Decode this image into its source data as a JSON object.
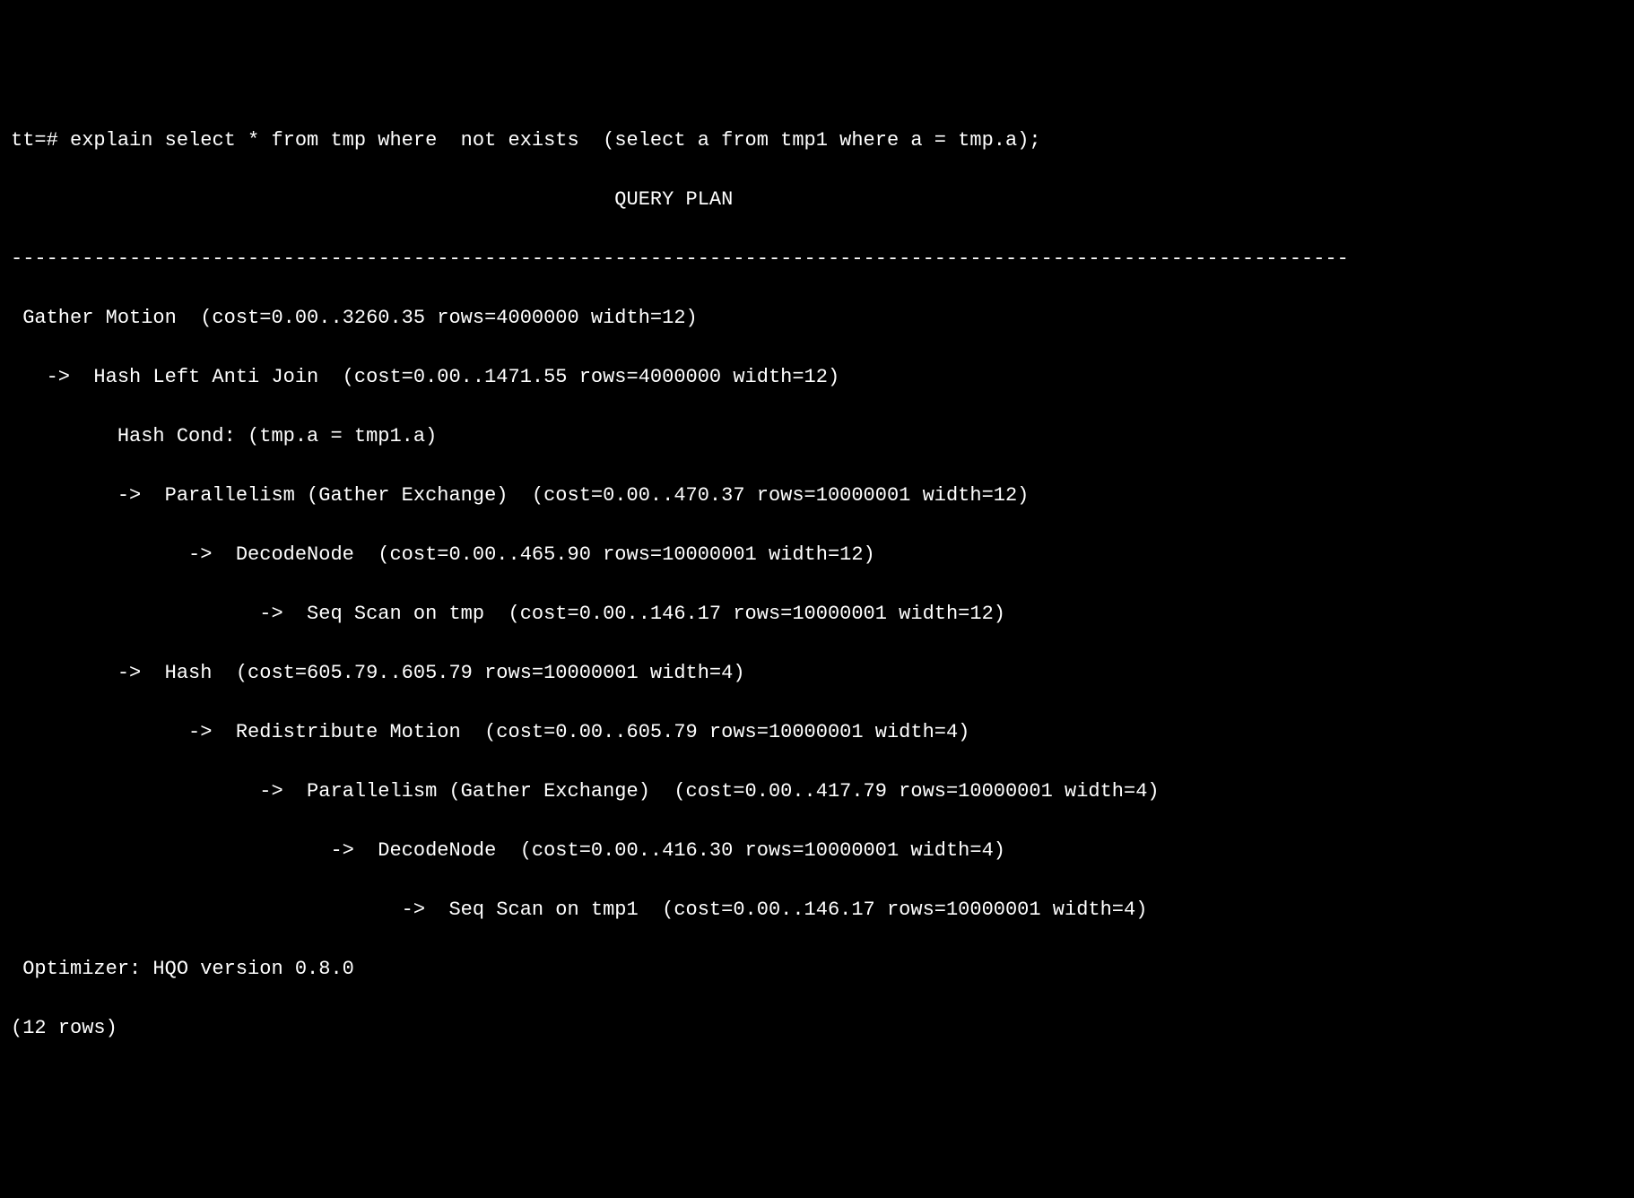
{
  "terminal": {
    "prompt": "tt=# ",
    "command": "explain select * from tmp where  not exists  (select a from tmp1 where a = tmp.a);",
    "plan_title": "                                                   QUERY PLAN",
    "separator": "-----------------------------------------------------------------------------------------------------------------",
    "plan_lines": [
      " Gather Motion  (cost=0.00..3260.35 rows=4000000 width=12)",
      "   ->  Hash Left Anti Join  (cost=0.00..1471.55 rows=4000000 width=12)",
      "         Hash Cond: (tmp.a = tmp1.a)",
      "         ->  Parallelism (Gather Exchange)  (cost=0.00..470.37 rows=10000001 width=12)",
      "               ->  DecodeNode  (cost=0.00..465.90 rows=10000001 width=12)",
      "                     ->  Seq Scan on tmp  (cost=0.00..146.17 rows=10000001 width=12)",
      "         ->  Hash  (cost=605.79..605.79 rows=10000001 width=4)",
      "               ->  Redistribute Motion  (cost=0.00..605.79 rows=10000001 width=4)",
      "                     ->  Parallelism (Gather Exchange)  (cost=0.00..417.79 rows=10000001 width=4)",
      "                           ->  DecodeNode  (cost=0.00..416.30 rows=10000001 width=4)",
      "                                 ->  Seq Scan on tmp1  (cost=0.00..146.17 rows=10000001 width=4)",
      " Optimizer: HQO version 0.8.0",
      "(12 rows)"
    ]
  }
}
